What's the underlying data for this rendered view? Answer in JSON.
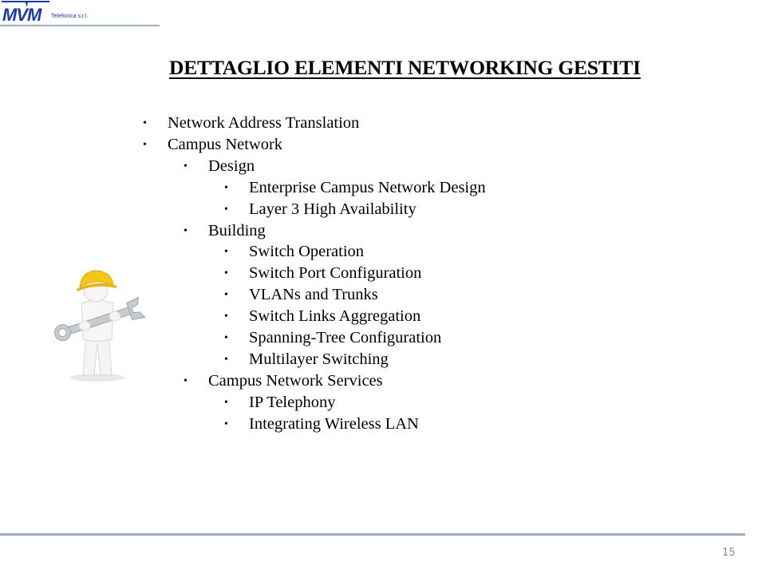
{
  "header": {
    "logo_text": "MVM",
    "logo_subtitle": "Telefonica s.r.l.",
    "brand_color": "#1a3aa8",
    "rule_color": "#9aaec4"
  },
  "slide": {
    "title": "DETTAGLIO ELEMENTI NETWORKING GESTITI",
    "items": [
      {
        "level": 1,
        "text": "Network Address Translation"
      },
      {
        "level": 1,
        "text": "Campus Network"
      },
      {
        "level": 2,
        "text": "Design"
      },
      {
        "level": 3,
        "text": "Enterprise Campus Network Design"
      },
      {
        "level": 3,
        "text": "Layer 3 High Availability"
      },
      {
        "level": 2,
        "text": "Building"
      },
      {
        "level": 3,
        "text": "Switch Operation"
      },
      {
        "level": 3,
        "text": "Switch Port Configuration"
      },
      {
        "level": 3,
        "text": "VLANs and Trunks"
      },
      {
        "level": 3,
        "text": "Switch Links Aggregation"
      },
      {
        "level": 3,
        "text": "Spanning-Tree Configuration"
      },
      {
        "level": 3,
        "text": "Multilayer Switching"
      },
      {
        "level": 2,
        "text": "Campus Network Services"
      },
      {
        "level": 3,
        "text": "IP Telephony"
      },
      {
        "level": 3,
        "text": "Integrating Wireless LAN"
      }
    ],
    "bullet": "•",
    "illustration": "worker-with-wrench-icon"
  },
  "footer": {
    "page_number": "15"
  }
}
